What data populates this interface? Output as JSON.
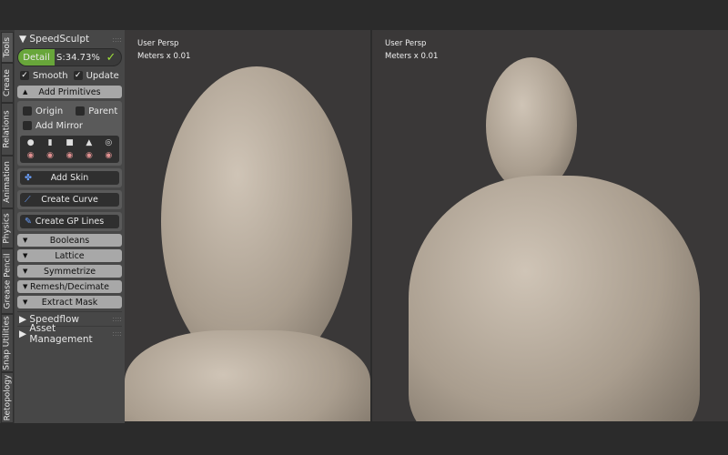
{
  "tabs": [
    "Tools",
    "Create",
    "Relations",
    "Animation",
    "Physics",
    "Grease Pencil",
    "Snap Utilities",
    "Retopology"
  ],
  "panel": {
    "title": "SpeedSculpt",
    "detail_label": "Detail",
    "detail_value": "S:34.73%",
    "smooth": "Smooth",
    "update": "Update",
    "add_primitives": "Add Primitives",
    "origin": "Origin",
    "parent": "Parent",
    "add_mirror": "Add Mirror",
    "add_skin": "Add Skin",
    "create_curve": "Create Curve",
    "create_gp_lines": "Create GP Lines",
    "sections": [
      "Booleans",
      "Lattice",
      "Symmetrize",
      "Remesh/Decimate",
      "Extract Mask"
    ],
    "speedflow": "Speedflow",
    "asset_management": "Asset Management"
  },
  "viewports": [
    {
      "view": "User Persp",
      "units": "Meters x 0.01"
    },
    {
      "view": "User Persp",
      "units": "Meters x 0.01"
    }
  ],
  "colors": {
    "accent": "#68a63a",
    "check": "#9fdf3a"
  }
}
